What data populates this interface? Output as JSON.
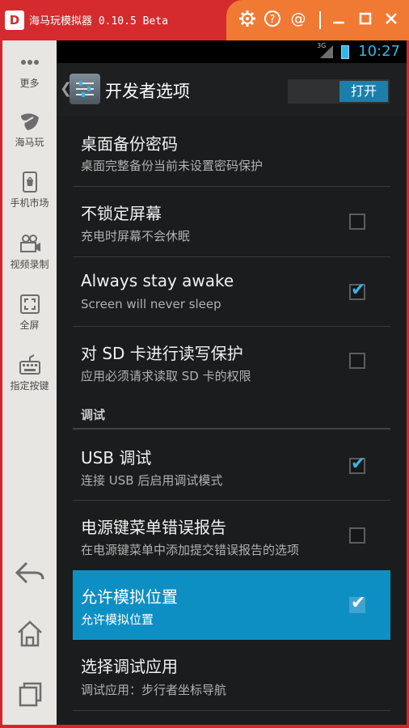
{
  "window": {
    "logo_text": "D",
    "title": "海马玩模拟器 0.10.5 Beta",
    "tool_icons": [
      "gear-icon",
      "help-icon",
      "at-icon"
    ],
    "win_controls": [
      "minimize-icon",
      "maximize-icon",
      "close-icon"
    ]
  },
  "sidebar": {
    "items": [
      {
        "icon": "more-icon",
        "label": "更多"
      },
      {
        "icon": "haima-icon",
        "label": "海马玩"
      },
      {
        "icon": "phone-market-icon",
        "label": "手机市场"
      },
      {
        "icon": "video-record-icon",
        "label": "视频录制"
      },
      {
        "icon": "fullscreen-icon",
        "label": "全屏"
      },
      {
        "icon": "keymap-icon",
        "label": "指定按键"
      }
    ],
    "nav_icons": [
      "back-icon",
      "home-icon",
      "recents-icon"
    ]
  },
  "statusbar": {
    "network": "3G",
    "time": "10:27"
  },
  "actionbar": {
    "title": "开发者选项",
    "toggle_label": "打开"
  },
  "list": {
    "rows": [
      {
        "title": "桌面备份密码",
        "subtitle": "桌面完整备份当前未设置密码保护",
        "has_checkbox": false
      },
      {
        "title": "不锁定屏幕",
        "subtitle": "充电时屏幕不会休眠",
        "has_checkbox": true,
        "checked": false
      },
      {
        "title": "Always stay awake",
        "subtitle": "Screen will never sleep",
        "has_checkbox": true,
        "checked": true
      },
      {
        "title": "对 SD 卡进行读写保护",
        "subtitle": "应用必须请求读取 SD 卡的权限",
        "has_checkbox": true,
        "checked": false
      }
    ],
    "section_debug": "调试",
    "debug_rows": [
      {
        "title": "USB 调试",
        "subtitle": "连接 USB 后启用调试模式",
        "has_checkbox": true,
        "checked": true
      },
      {
        "title": "电源键菜单错误报告",
        "subtitle": "在电源键菜单中添加提交错误报告的选项",
        "has_checkbox": true,
        "checked": false
      },
      {
        "title": "允许模拟位置",
        "subtitle": "允许模拟位置",
        "has_checkbox": true,
        "checked": true,
        "highlighted": true
      },
      {
        "title": "选择调试应用",
        "subtitle": "调试应用：步行者坐标导航",
        "has_checkbox": false
      }
    ]
  },
  "colors": {
    "frame_red": "#d52b2e",
    "tools_orange": "#f07a34",
    "accent_blue": "#33b5e5",
    "highlight_blue": "#0e8fc4"
  }
}
